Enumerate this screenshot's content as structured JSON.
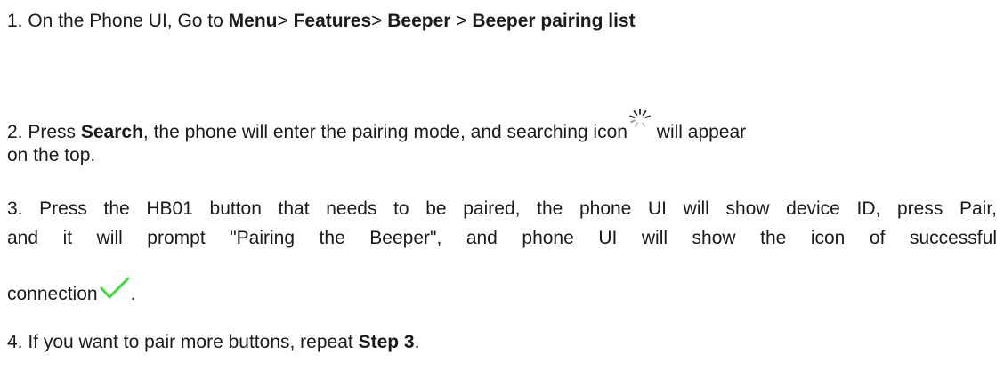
{
  "step1": {
    "prefix": "1. On the Phone UI,  Go to ",
    "menu": "Menu",
    "sep1": "> ",
    "features": "Features",
    "sep2": "> ",
    "beeper": "Beeper",
    "sep3": " > ",
    "pairing_list": "Beeper pairing list"
  },
  "step2": {
    "prefix": "2. Press ",
    "search": "Search",
    "middle": ",  the phone will enter the pairing mode, and searching icon",
    "after_icon": "  will appear",
    "line2": "on the top.",
    "icon": "searching-spinner-icon"
  },
  "step3": {
    "line1": "3. Press the HB01 button that needs to be paired, the phone UI will show device ID, press Pair,",
    "line2": "and it will prompt \"Pairing the Beeper\", and phone UI will show the icon of successful",
    "line3_prefix": "connection",
    "line3_suffix": ".",
    "icon": "success-check-icon",
    "icon_color": "#3ddc3d"
  },
  "step4": {
    "prefix": "4. If you want to pair more buttons, repeat ",
    "step_ref": "Step 3",
    "suffix": "."
  }
}
